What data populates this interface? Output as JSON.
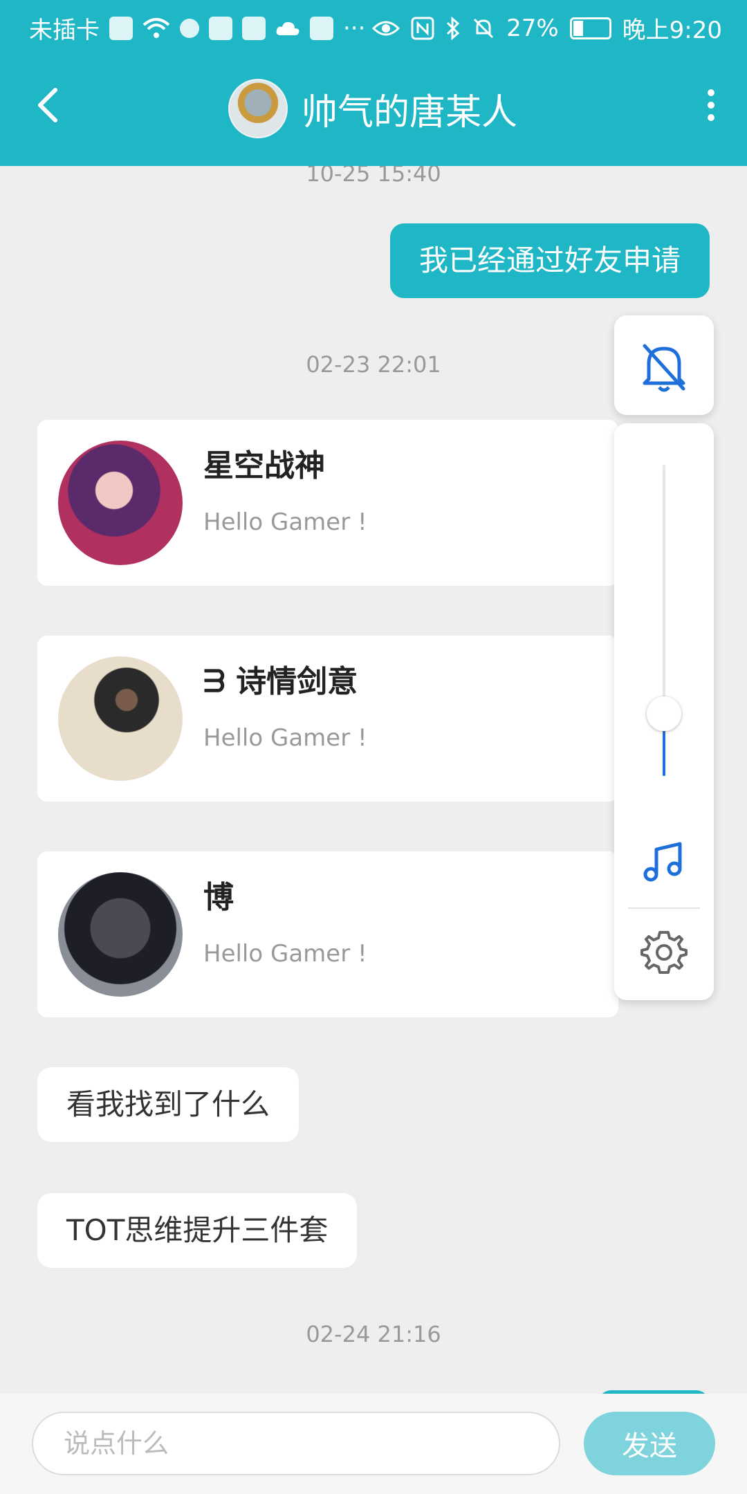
{
  "status_bar": {
    "carrier": "未插卡",
    "more": "···",
    "battery": "27%",
    "time": "晚上9:20"
  },
  "header": {
    "title": "帅气的唐某人",
    "back_icon": "chevron-left-icon",
    "menu_icon": "more-vertical-icon"
  },
  "messages": {
    "time1": "10-25 15:40",
    "bubble1": "我已经通过好友申请",
    "time2": "02-23 22:01",
    "cards": [
      {
        "name": "星空战神",
        "message": "Hello Gamer !"
      },
      {
        "name": "ᗱ 诗情剑意",
        "message": "Hello Gamer !"
      },
      {
        "name": "博",
        "message": "Hello Gamer !"
      }
    ],
    "bubble2": "看我找到了什么",
    "bubble3": "TOT思维提升三件套",
    "time3": "02-24 21:16"
  },
  "volume_panel": {
    "level": 0.2,
    "mute_icon": "bell-off-icon",
    "music_icon": "music-note-icon",
    "settings_icon": "gear-icon"
  },
  "input_bar": {
    "placeholder": "说点什么",
    "value": "",
    "send_label": "发送"
  },
  "colors": {
    "accent": "#1fb6c6",
    "slider": "#1e6fd9",
    "send_disabled": "#7fd3dc"
  }
}
